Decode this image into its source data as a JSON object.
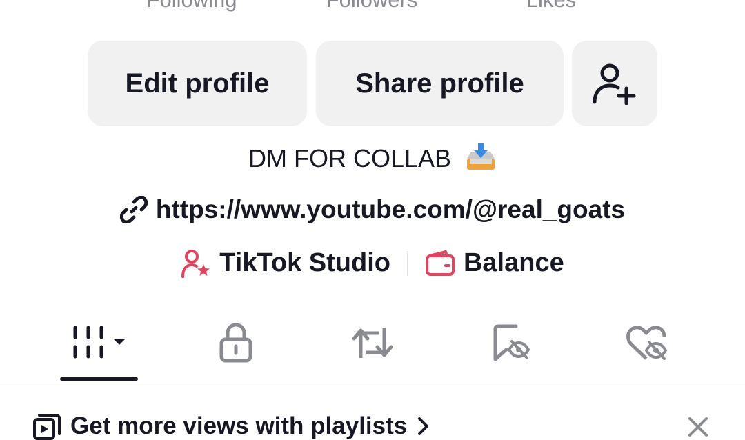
{
  "stats": {
    "following_label": "Following",
    "followers_label": "Followers",
    "likes_label": "Likes"
  },
  "actions": {
    "edit_profile": "Edit profile",
    "share_profile": "Share profile"
  },
  "bio": {
    "text": "DM FOR COLLAB"
  },
  "link": {
    "url": "https://www.youtube.com/@real_goats"
  },
  "tools": {
    "studio_label": "TikTok Studio",
    "balance_label": "Balance"
  },
  "tabs": [
    "videos-grid",
    "private",
    "reposts",
    "favorites",
    "liked"
  ],
  "promo": {
    "text": "Get more views with playlists"
  },
  "colors": {
    "accent": "#e0455f",
    "text": "#161823",
    "button_bg": "#f1f1f2",
    "muted": "#8a8b91"
  }
}
